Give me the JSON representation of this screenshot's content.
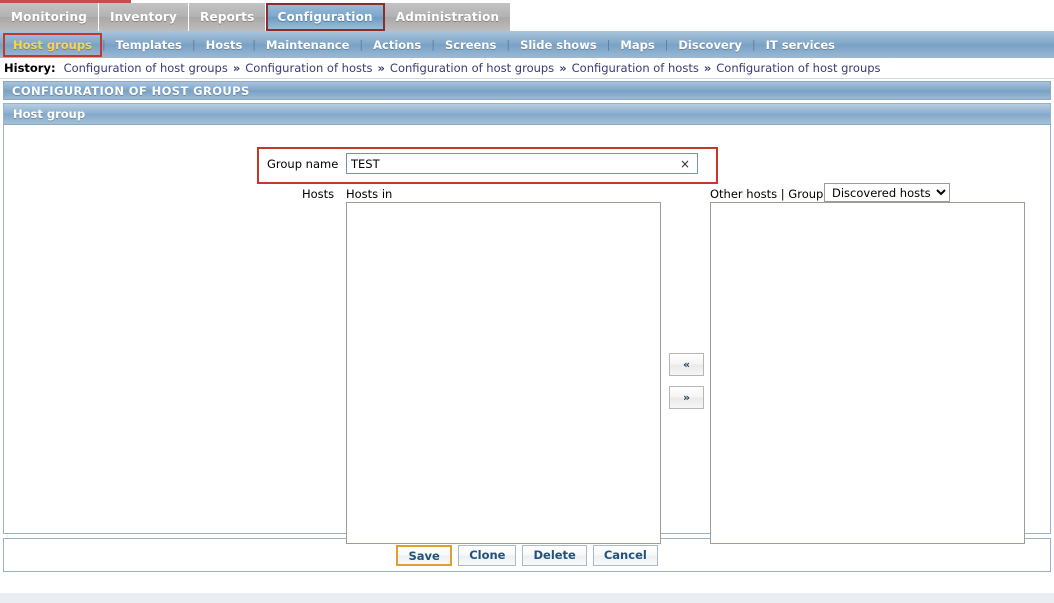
{
  "top_menu": {
    "items": [
      {
        "label": "Monitoring",
        "active": false,
        "selected": false
      },
      {
        "label": "Inventory",
        "active": false,
        "selected": false
      },
      {
        "label": "Reports",
        "active": false,
        "selected": false
      },
      {
        "label": "Configuration",
        "active": true,
        "selected": true
      },
      {
        "label": "Administration",
        "active": false,
        "selected": false
      }
    ]
  },
  "sub_menu": {
    "items": [
      {
        "label": "Host groups",
        "active": true,
        "selected": true
      },
      {
        "label": "Templates",
        "active": false,
        "selected": false
      },
      {
        "label": "Hosts",
        "active": false,
        "selected": false
      },
      {
        "label": "Maintenance",
        "active": false,
        "selected": false
      },
      {
        "label": "Actions",
        "active": false,
        "selected": false
      },
      {
        "label": "Screens",
        "active": false,
        "selected": false
      },
      {
        "label": "Slide shows",
        "active": false,
        "selected": false
      },
      {
        "label": "Maps",
        "active": false,
        "selected": false
      },
      {
        "label": "Discovery",
        "active": false,
        "selected": false
      },
      {
        "label": "IT services",
        "active": false,
        "selected": false
      }
    ],
    "separator": "|"
  },
  "history": {
    "label": "History:",
    "separator": "»",
    "items": [
      "Configuration of host groups",
      "Configuration of hosts",
      "Configuration of host groups",
      "Configuration of hosts",
      "Configuration of host groups"
    ]
  },
  "page": {
    "title": "CONFIGURATION OF HOST GROUPS"
  },
  "form": {
    "header": "Host group",
    "group_name": {
      "label": "Group name",
      "value": "TEST",
      "placeholder": "",
      "clear_icon": "×"
    },
    "hosts": {
      "row_label": "Hosts",
      "hosts_in_label": "Hosts in",
      "other_hosts_label": "Other hosts | Group",
      "hosts_in_options": [],
      "other_hosts_options": [],
      "group_select": {
        "selected": "Discovered hosts",
        "options": [
          "Discovered hosts"
        ]
      },
      "move_left_label": "«",
      "move_right_label": "»"
    }
  },
  "footer": {
    "buttons": [
      {
        "label": "Save",
        "focused": true
      },
      {
        "label": "Clone",
        "focused": false
      },
      {
        "label": "Delete",
        "focused": false
      },
      {
        "label": "Cancel",
        "focused": false
      }
    ]
  },
  "colors": {
    "accent_blue": "#7fa6c8",
    "selection_red": "#c0392b",
    "active_submenu_text": "#ffd24d",
    "focus_gold": "#e0a030",
    "history_link": "#3a3a78"
  }
}
